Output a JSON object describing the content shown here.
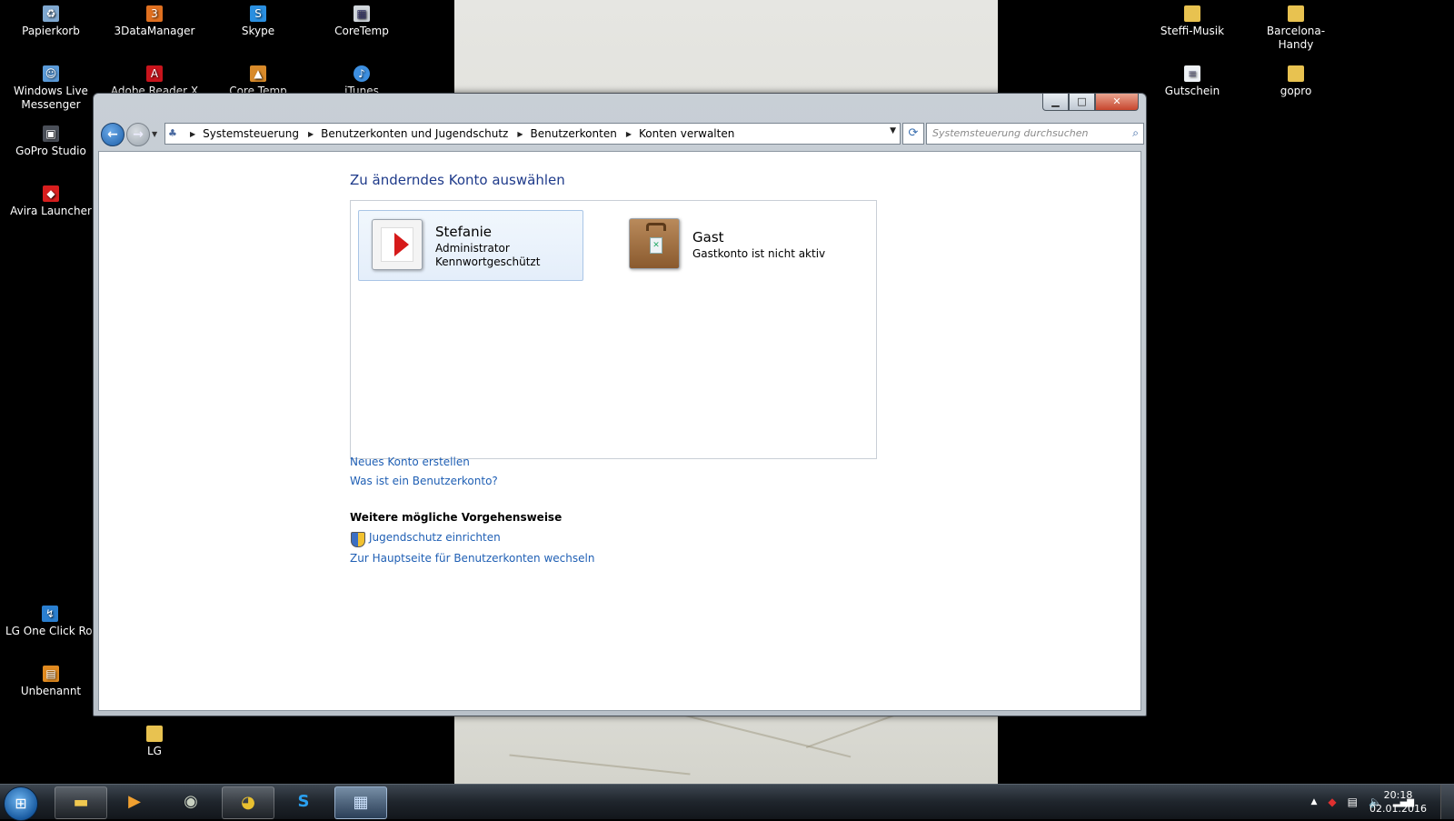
{
  "desktop": {
    "icons": [
      {
        "label": "Papierkorb"
      },
      {
        "label": "3DataManager"
      },
      {
        "label": "Skype"
      },
      {
        "label": "CoreTemp"
      },
      {
        "label": "Windows Live Messenger"
      },
      {
        "label": "Adobe Reader X"
      },
      {
        "label": "Core Temp"
      },
      {
        "label": "iTunes"
      },
      {
        "label": "GoPro Studio"
      },
      {
        "label": "Avira Launcher"
      },
      {
        "label": "LG One Click Roo"
      },
      {
        "label": "Unbenannt"
      },
      {
        "label": "LG"
      },
      {
        "label": "Steffi-Musik"
      },
      {
        "label": "Barcelona-Handy"
      },
      {
        "label": "Gutschein"
      },
      {
        "label": "gopro"
      }
    ]
  },
  "window": {
    "breadcrumbs": [
      "Systemsteuerung",
      "Benutzerkonten und Jugendschutz",
      "Benutzerkonten",
      "Konten verwalten"
    ],
    "search_placeholder": "Systemsteuerung durchsuchen"
  },
  "content": {
    "heading": "Zu änderndes Konto auswählen",
    "accounts": [
      {
        "name": "Stefanie",
        "line1": "Administrator",
        "line2": "Kennwortgeschützt"
      },
      {
        "name": "Gast",
        "line1": "Gastkonto ist nicht aktiv"
      }
    ],
    "links": {
      "new_account": "Neues Konto erstellen",
      "what_is": "Was ist ein Benutzerkonto?"
    },
    "more_heading": "Weitere mögliche Vorgehensweise",
    "more_links": {
      "parental": "Jugendschutz einrichten",
      "main_page": "Zur Hauptseite für Benutzerkonten wechseln"
    }
  },
  "taskbar": {
    "time": "20:18",
    "date": "02.01.2016"
  }
}
